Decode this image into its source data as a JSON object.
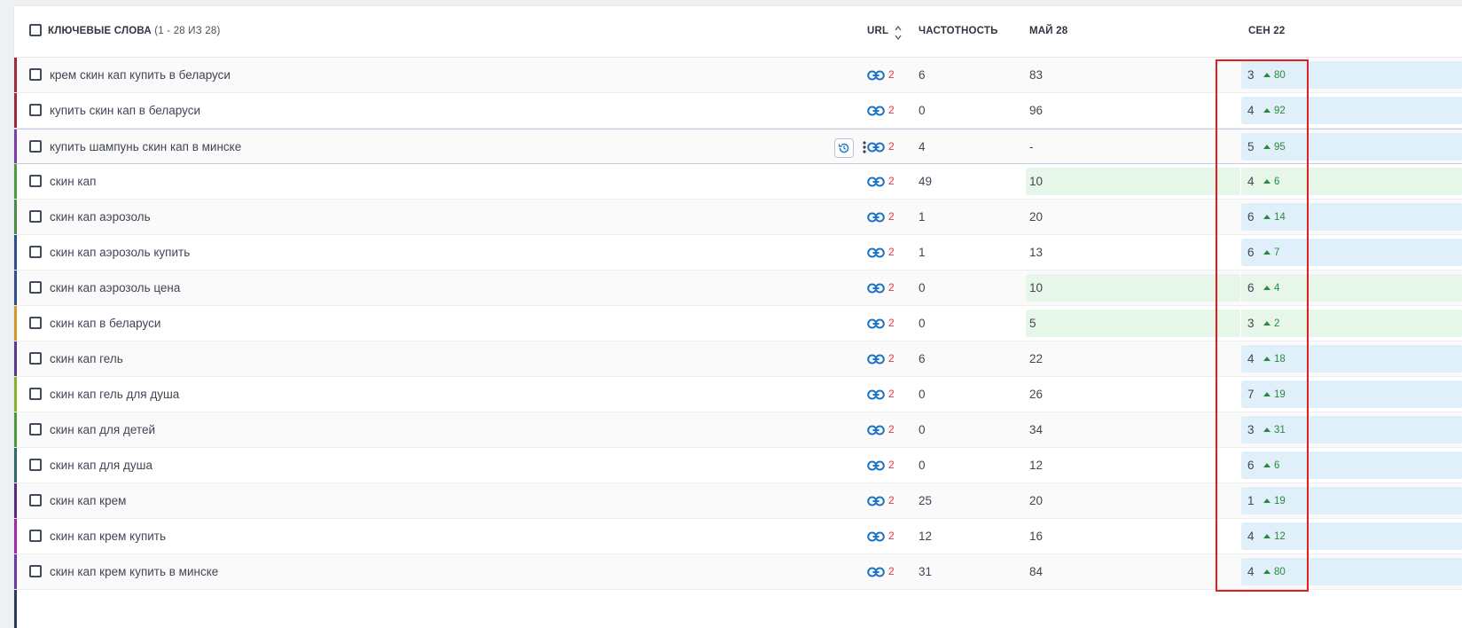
{
  "header": {
    "keywords_label": "КЛЮЧЕВЫЕ СЛОВА",
    "keywords_count": "(1 - 28 ИЗ 28)",
    "url_label": "URL",
    "frequency_label": "ЧАСТОТНОСТЬ",
    "may_label": "МАЙ 28",
    "sep_label": "СЕН 22"
  },
  "colors": {
    "link": "#1a73c9",
    "link_count": "#e0373c",
    "up": "#2b8a3e",
    "highlight_box": "#e01e22"
  },
  "rows": [
    {
      "keyword": "крем скин кап купить в беларуси",
      "links": "2",
      "freq": "6",
      "may": "83",
      "may_green": false,
      "sep": "3",
      "delta": "80",
      "sep_bg": "blue",
      "bar": "#9c2a3a"
    },
    {
      "keyword": "купить скин кап в беларуси",
      "links": "2",
      "freq": "0",
      "may": "96",
      "may_green": false,
      "sep": "4",
      "delta": "92",
      "sep_bg": "blue",
      "bar": "#9c2a3a"
    },
    {
      "keyword": "купить шампунь скин кап в минске",
      "links": "2",
      "freq": "4",
      "may": "-",
      "may_green": false,
      "sep": "5",
      "delta": "95",
      "sep_bg": "blue",
      "bar": "#7a3fa0",
      "highlight": true
    },
    {
      "keyword": "скин кап",
      "links": "2",
      "freq": "49",
      "may": "10",
      "may_green": true,
      "sep": "4",
      "delta": "6",
      "sep_bg": "green",
      "bar": "#4c9a3a"
    },
    {
      "keyword": "скин кап аэрозоль",
      "links": "2",
      "freq": "1",
      "may": "20",
      "may_green": false,
      "sep": "6",
      "delta": "14",
      "sep_bg": "blue",
      "bar": "#4c8a4a"
    },
    {
      "keyword": "скин кап аэрозоль купить",
      "links": "2",
      "freq": "1",
      "may": "13",
      "may_green": false,
      "sep": "6",
      "delta": "7",
      "sep_bg": "blue",
      "bar": "#2f4f8a"
    },
    {
      "keyword": "скин кап аэрозоль цена",
      "links": "2",
      "freq": "0",
      "may": "10",
      "may_green": true,
      "sep": "6",
      "delta": "4",
      "sep_bg": "green",
      "bar": "#2f4f8a"
    },
    {
      "keyword": "скин кап в беларуси",
      "links": "2",
      "freq": "0",
      "may": "5",
      "may_green": true,
      "sep": "3",
      "delta": "2",
      "sep_bg": "green",
      "bar": "#d19a2a"
    },
    {
      "keyword": "скин кап гель",
      "links": "2",
      "freq": "6",
      "may": "22",
      "may_green": false,
      "sep": "4",
      "delta": "18",
      "sep_bg": "blue",
      "bar": "#5a3a8a"
    },
    {
      "keyword": "скин кап гель для душа",
      "links": "2",
      "freq": "0",
      "may": "26",
      "may_green": false,
      "sep": "7",
      "delta": "19",
      "sep_bg": "blue",
      "bar": "#8ab02a"
    },
    {
      "keyword": "скин кап для детей",
      "links": "2",
      "freq": "0",
      "may": "34",
      "may_green": false,
      "sep": "3",
      "delta": "31",
      "sep_bg": "blue",
      "bar": "#4c9a3a"
    },
    {
      "keyword": "скин кап для душа",
      "links": "2",
      "freq": "0",
      "may": "12",
      "may_green": false,
      "sep": "6",
      "delta": "6",
      "sep_bg": "blue",
      "bar": "#2f6a6a"
    },
    {
      "keyword": "скин кап крем",
      "links": "2",
      "freq": "25",
      "may": "20",
      "may_green": false,
      "sep": "1",
      "delta": "19",
      "sep_bg": "blue",
      "bar": "#5a2a7a"
    },
    {
      "keyword": "скин кап крем купить",
      "links": "2",
      "freq": "12",
      "may": "16",
      "may_green": false,
      "sep": "4",
      "delta": "12",
      "sep_bg": "blue",
      "bar": "#a02aa0"
    },
    {
      "keyword": "скин кап крем купить в минске",
      "links": "2",
      "freq": "31",
      "may": "84",
      "may_green": false,
      "sep": "4",
      "delta": "80",
      "sep_bg": "blue",
      "bar": "#6a3aa0"
    }
  ]
}
